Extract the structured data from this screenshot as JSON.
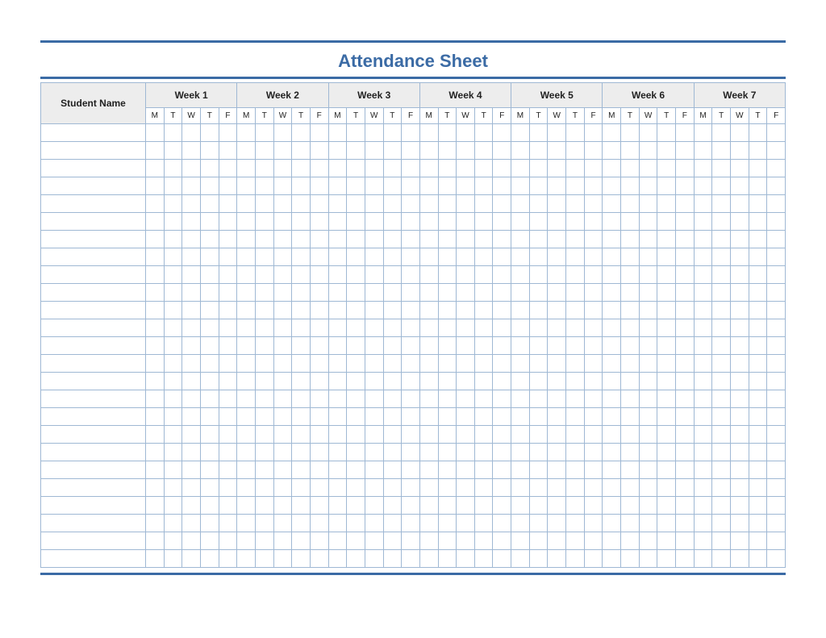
{
  "title": "Attendance Sheet",
  "columns": {
    "name_header": "Student Name",
    "weeks": [
      "Week 1",
      "Week 2",
      "Week 3",
      "Week 4",
      "Week 5",
      "Week 6",
      "Week 7"
    ],
    "days": [
      "M",
      "T",
      "W",
      "T",
      "F"
    ]
  },
  "student_rows": 25
}
